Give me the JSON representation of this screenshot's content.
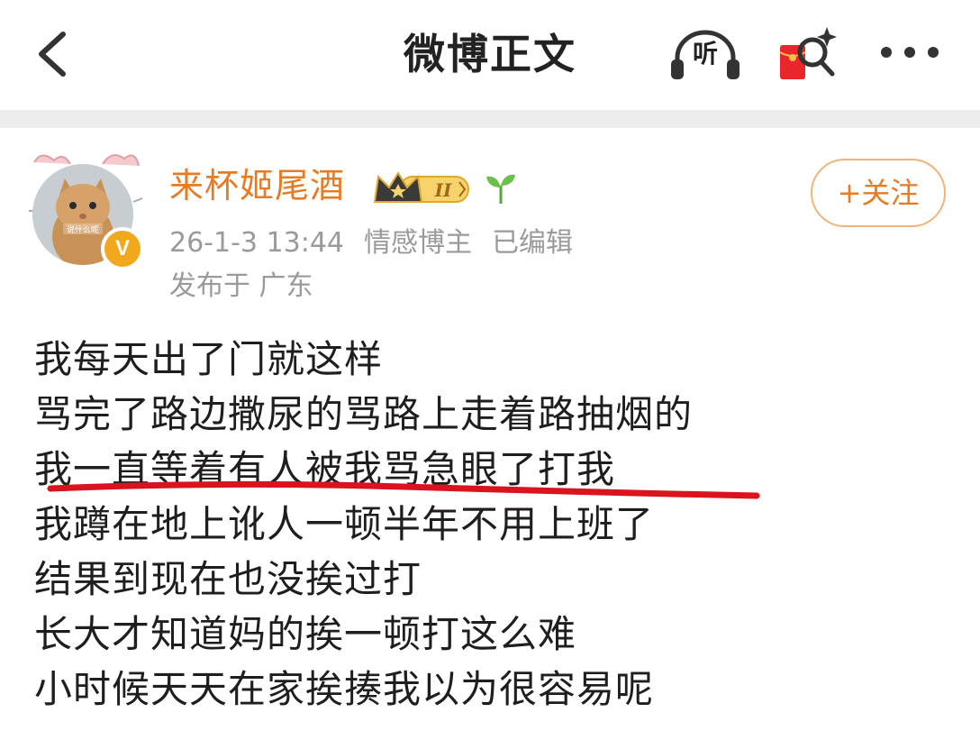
{
  "header": {
    "title": "微博正文",
    "listen_label": "听"
  },
  "post": {
    "author": {
      "name": "来杯姬尾酒",
      "avatar_caption": "说什么呢",
      "verified_mark": "V",
      "vip_level": "II"
    },
    "meta": {
      "time": "26-1-3 13:44",
      "tag": "情感博主",
      "edited": "已编辑"
    },
    "location": "发布于 广东",
    "follow_label": "+关注",
    "lines": [
      "我每天出了门就这样",
      "骂完了路边撒尿的骂路上走着路抽烟的",
      "我一直等着有人被我骂急眼了打我",
      "我蹲在地上讹人一顿半年不用上班了",
      "结果到现在也没挨过打",
      "长大才知道妈的挨一顿打这么难",
      "小时候天天在家挨揍我以为很容易呢"
    ]
  },
  "colors": {
    "accent_orange": "#e87b22",
    "meta_gray": "#9a9a9a",
    "underline_red": "#d9141e",
    "gold": "#f2a81d"
  }
}
